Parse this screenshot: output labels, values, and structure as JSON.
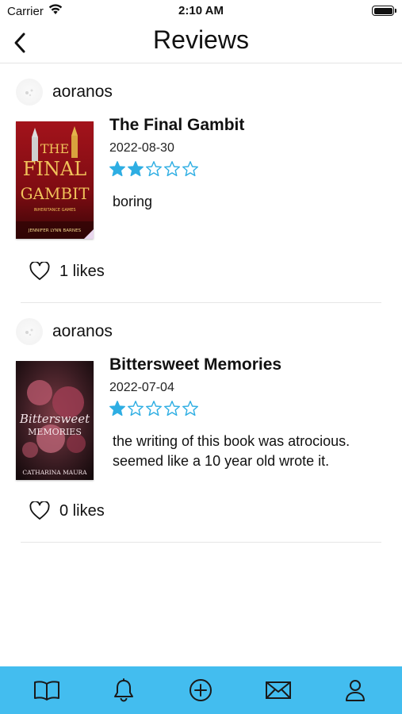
{
  "status_bar": {
    "carrier": "Carrier",
    "time": "2:10 AM",
    "wifi_icon": "wifi-icon",
    "battery_icon": "battery-icon"
  },
  "header": {
    "title": "Reviews",
    "back_icon": "chevron-left-icon"
  },
  "colors": {
    "accent": "#43bdef",
    "star": "#2eaee3",
    "divider": "#e6e6e6"
  },
  "reviews": [
    {
      "author": "aoranos",
      "book_title": "The Final Gambit",
      "date": "2022-08-30",
      "rating": 2,
      "max_rating": 5,
      "text": "boring",
      "likes": "1 likes",
      "cover": {
        "title_line1": "THE",
        "title_line2": "FINAL",
        "title_line3": "GAMBIT",
        "author": "JENNIFER LYNN BARNES",
        "series": "INHERITANCE GAMES"
      }
    },
    {
      "author": "aoranos",
      "book_title": "Bittersweet Memories",
      "date": "2022-07-04",
      "rating": 1,
      "max_rating": 5,
      "text": "the writing of this book was atrocious. seemed like a 10 year old wrote it.",
      "likes": "0 likes",
      "cover": {
        "title_line1": "Bittersweet",
        "title_line2": "MEMORIES",
        "author": "CATHARINA MAURA"
      }
    }
  ],
  "tab_bar": {
    "items": [
      {
        "icon": "book-icon",
        "name": "tab-library"
      },
      {
        "icon": "bell-icon",
        "name": "tab-notifications"
      },
      {
        "icon": "plus-circle-icon",
        "name": "tab-add"
      },
      {
        "icon": "mail-icon",
        "name": "tab-messages"
      },
      {
        "icon": "person-icon",
        "name": "tab-profile"
      }
    ]
  }
}
